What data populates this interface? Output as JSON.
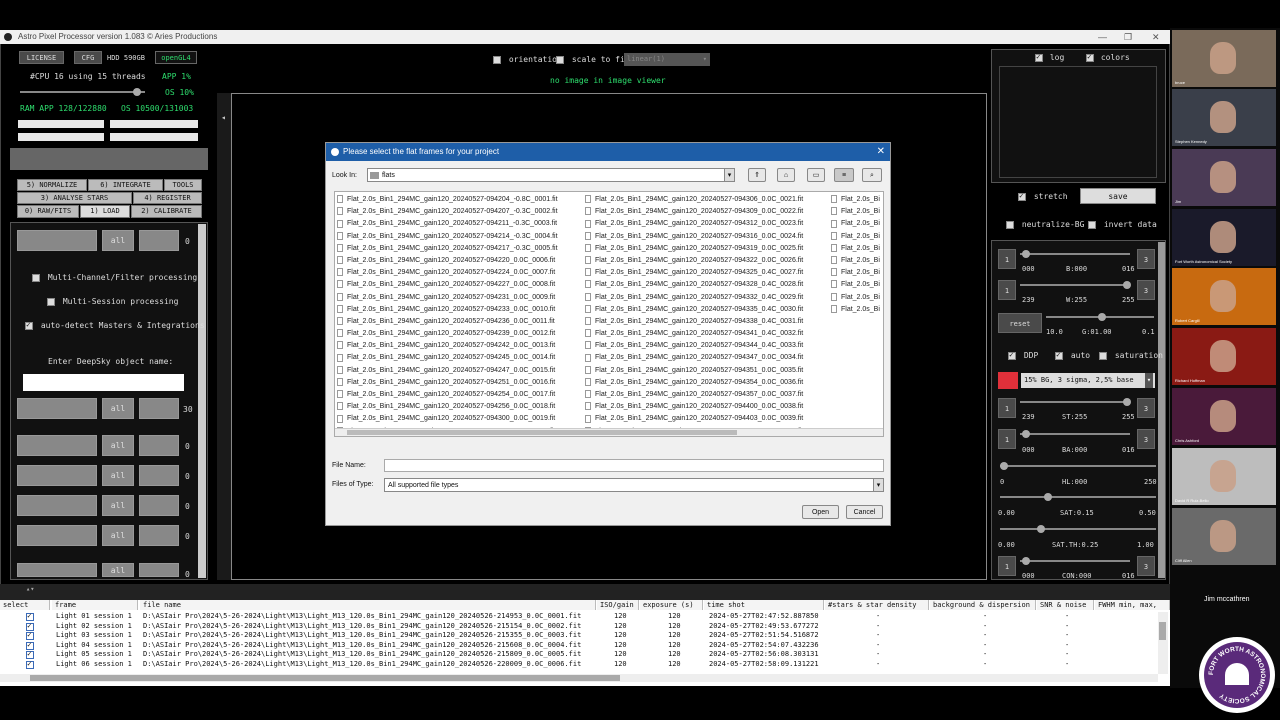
{
  "app": {
    "title": "Astro Pixel Processor version 1.083 © Aries Productions",
    "window_controls": [
      "—",
      "❐",
      "✕"
    ]
  },
  "top_left": {
    "license": "LICENSE",
    "cfg": "CFG",
    "hdd": "HDD 590GB",
    "opengl": "openGL4",
    "cpu_text": "#CPU 16  using 15 threads",
    "app_pct": "APP 1%",
    "os_pct": "OS 10%",
    "ram_text": "RAM  APP 128/122880",
    "os_ram": "OS 10500/131003"
  },
  "tabs": {
    "row1": [
      "5) NORMALIZE",
      "6) INTEGRATE",
      "TOOLS"
    ],
    "row2": [
      "3) ANALYSE STARS",
      "4) REGISTER"
    ],
    "row3": [
      "0) RAW/FITS",
      "1) LOAD",
      "2) CALIBRATE"
    ]
  },
  "load_panel": {
    "all_label": "all",
    "count0": "0",
    "multi_channel": "Multi-Channel/Filter processing",
    "multi_session": "Multi-Session processing",
    "auto_detect": "auto-detect Masters & Integrations",
    "deepsky_label": "Enter DeepSky object name:",
    "deepsky_value": "",
    "count30": "30",
    "counts": [
      "0",
      "0",
      "0",
      "0",
      "0"
    ]
  },
  "viewer": {
    "orientation": "orientation",
    "scale_to_fit": "scale to fit",
    "stretch_select": "linear(1)",
    "no_image": "no image in image viewer"
  },
  "right_panel": {
    "log": "log",
    "colors": "colors",
    "stretch": "stretch",
    "save": "save",
    "neutralize": "neutralize-BG",
    "invert": "invert data",
    "b_min": "000",
    "b_label": "B:000",
    "b_max": "016",
    "w_min": "239",
    "w_label": "W:255",
    "w_max": "255",
    "reset": "reset",
    "g_min": "10.0",
    "g_label": "G:01.00",
    "g_max": "0.1",
    "ddp": "DDP",
    "auto": "auto",
    "saturation": "saturation",
    "preset": "15% BG, 3 sigma, 2,5% base",
    "st_min": "239",
    "st_label": "ST:255",
    "st_max": "255",
    "ba_min": "000",
    "ba_label": "BA:000",
    "ba_max": "016",
    "hl_min": "0",
    "hl_label": "HL:000",
    "hl_max": "250",
    "sat_min": "0.00",
    "sat_label": "SAT:0.15",
    "sat_max": "0.50",
    "satth_min": "0.00",
    "satth_label": "SAT.TH:0.25",
    "satth_max": "1.00",
    "con_min": "000",
    "con_label": "CON:000",
    "con_max": "016",
    "spin_1": "1",
    "spin_3": "3"
  },
  "dialog": {
    "title": "Please select the flat frames for your project",
    "look_in_label": "Look In:",
    "look_in_value": "flats",
    "file_name_label": "File Name:",
    "file_name_value": "",
    "file_type_label": "Files of Type:",
    "file_type_value": "All supported file types",
    "open": "Open",
    "cancel": "Cancel",
    "col1": [
      "Flat_2.0s_Bin1_294MC_gain120_20240527-094204_-0.8C_0001.fit",
      "Flat_2.0s_Bin1_294MC_gain120_20240527-094207_-0.3C_0002.fit",
      "Flat_2.0s_Bin1_294MC_gain120_20240527-094211_-0.3C_0003.fit",
      "Flat_2.0s_Bin1_294MC_gain120_20240527-094214_-0.3C_0004.fit",
      "Flat_2.0s_Bin1_294MC_gain120_20240527-094217_-0.3C_0005.fit",
      "Flat_2.0s_Bin1_294MC_gain120_20240527-094220_0.0C_0006.fit",
      "Flat_2.0s_Bin1_294MC_gain120_20240527-094224_0.0C_0007.fit",
      "Flat_2.0s_Bin1_294MC_gain120_20240527-094227_0.0C_0008.fit",
      "Flat_2.0s_Bin1_294MC_gain120_20240527-094231_0.0C_0009.fit",
      "Flat_2.0s_Bin1_294MC_gain120_20240527-094233_0.0C_0010.fit",
      "Flat_2.0s_Bin1_294MC_gain120_20240527-094236_0.0C_0011.fit",
      "Flat_2.0s_Bin1_294MC_gain120_20240527-094239_0.0C_0012.fit",
      "Flat_2.0s_Bin1_294MC_gain120_20240527-094242_0.0C_0013.fit",
      "Flat_2.0s_Bin1_294MC_gain120_20240527-094245_0.0C_0014.fit",
      "Flat_2.0s_Bin1_294MC_gain120_20240527-094247_0.0C_0015.fit",
      "Flat_2.0s_Bin1_294MC_gain120_20240527-094251_0.0C_0016.fit",
      "Flat_2.0s_Bin1_294MC_gain120_20240527-094254_0.0C_0017.fit",
      "Flat_2.0s_Bin1_294MC_gain120_20240527-094256_0.0C_0018.fit",
      "Flat_2.0s_Bin1_294MC_gain120_20240527-094300_0.0C_0019.fit",
      "Flat_2.0s_Bin1_294MC_gain120_20240527-094303_0.0C_0020.fit"
    ],
    "col2": [
      "Flat_2.0s_Bin1_294MC_gain120_20240527-094306_0.0C_0021.fit",
      "Flat_2.0s_Bin1_294MC_gain120_20240527-094309_0.0C_0022.fit",
      "Flat_2.0s_Bin1_294MC_gain120_20240527-094312_0.0C_0023.fit",
      "Flat_2.0s_Bin1_294MC_gain120_20240527-094316_0.0C_0024.fit",
      "Flat_2.0s_Bin1_294MC_gain120_20240527-094319_0.0C_0025.fit",
      "Flat_2.0s_Bin1_294MC_gain120_20240527-094322_0.0C_0026.fit",
      "Flat_2.0s_Bin1_294MC_gain120_20240527-094325_0.4C_0027.fit",
      "Flat_2.0s_Bin1_294MC_gain120_20240527-094328_0.4C_0028.fit",
      "Flat_2.0s_Bin1_294MC_gain120_20240527-094332_0.4C_0029.fit",
      "Flat_2.0s_Bin1_294MC_gain120_20240527-094335_0.4C_0030.fit",
      "Flat_2.0s_Bin1_294MC_gain120_20240527-094338_0.4C_0031.fit",
      "Flat_2.0s_Bin1_294MC_gain120_20240527-094341_0.4C_0032.fit",
      "Flat_2.0s_Bin1_294MC_gain120_20240527-094344_0.4C_0033.fit",
      "Flat_2.0s_Bin1_294MC_gain120_20240527-094347_0.0C_0034.fit",
      "Flat_2.0s_Bin1_294MC_gain120_20240527-094351_0.0C_0035.fit",
      "Flat_2.0s_Bin1_294MC_gain120_20240527-094354_0.0C_0036.fit",
      "Flat_2.0s_Bin1_294MC_gain120_20240527-094357_0.0C_0037.fit",
      "Flat_2.0s_Bin1_294MC_gain120_20240527-094400_0.0C_0038.fit",
      "Flat_2.0s_Bin1_294MC_gain120_20240527-094403_0.0C_0039.fit",
      "Flat_2.0s_Bin1_294MC_gain120_20240527-094406_0.0C_0040.fit"
    ],
    "col3": [
      "Flat_2.0s_Bi",
      "Flat_2.0s_Bi",
      "Flat_2.0s_Bi",
      "Flat_2.0s_Bi",
      "Flat_2.0s_Bi",
      "Flat_2.0s_Bi",
      "Flat_2.0s_Bi",
      "Flat_2.0s_Bi",
      "Flat_2.0s_Bi",
      "Flat_2.0s_Bi"
    ]
  },
  "table": {
    "headers": [
      "select",
      "frame",
      "file name",
      "ISO/gain",
      "exposure (s)",
      "time shot",
      "#stars & star density",
      "background & dispersion",
      "SNR & noise",
      "FWHM min, max,"
    ],
    "rows": [
      {
        "frame": "Light 01 session 1",
        "file": "D:\\ASIair Pro\\2024\\5-26-2024\\Light\\M13\\Light_M13_120.0s_Bin1_294MC_gain120_20240526-214953_0.0C_0001.fit",
        "iso": "120",
        "exp": "120",
        "time": "2024-05-27T02:47:52.887850",
        "stars": "-",
        "bg": "-",
        "snr": "-"
      },
      {
        "frame": "Light 02 session 1",
        "file": "D:\\ASIair Pro\\2024\\5-26-2024\\Light\\M13\\Light_M13_120.0s_Bin1_294MC_gain120_20240526-215154_0.0C_0002.fit",
        "iso": "120",
        "exp": "120",
        "time": "2024-05-27T02:49:53.677272",
        "stars": "-",
        "bg": "-",
        "snr": "-"
      },
      {
        "frame": "Light 03 session 1",
        "file": "D:\\ASIair Pro\\2024\\5-26-2024\\Light\\M13\\Light_M13_120.0s_Bin1_294MC_gain120_20240526-215355_0.0C_0003.fit",
        "iso": "120",
        "exp": "120",
        "time": "2024-05-27T02:51:54.516872",
        "stars": "-",
        "bg": "-",
        "snr": "-"
      },
      {
        "frame": "Light 04 session 1",
        "file": "D:\\ASIair Pro\\2024\\5-26-2024\\Light\\M13\\Light_M13_120.0s_Bin1_294MC_gain120_20240526-215608_0.0C_0004.fit",
        "iso": "120",
        "exp": "120",
        "time": "2024-05-27T02:54:07.432236",
        "stars": "-",
        "bg": "-",
        "snr": "-"
      },
      {
        "frame": "Light 05 session 1",
        "file": "D:\\ASIair Pro\\2024\\5-26-2024\\Light\\M13\\Light_M13_120.0s_Bin1_294MC_gain120_20240526-215809_0.0C_0005.fit",
        "iso": "120",
        "exp": "120",
        "time": "2024-05-27T02:56:08.303131",
        "stars": "-",
        "bg": "-",
        "snr": "-"
      },
      {
        "frame": "Light 06 session 1",
        "file": "D:\\ASIair Pro\\2024\\5-26-2024\\Light\\M13\\Light_M13_120.0s_Bin1_294MC_gain120_20240526-220009_0.0C_0006.fit",
        "iso": "120",
        "exp": "120",
        "time": "2024-05-27T02:58:09.131221",
        "stars": "-",
        "bg": "-",
        "snr": "-"
      }
    ]
  },
  "participants": [
    {
      "name": "bruce",
      "color": "#7a6a5a"
    },
    {
      "name": "Stephen Kennedy",
      "color": "#3a3f4a"
    },
    {
      "name": "Jim",
      "color": "#4a3a55"
    },
    {
      "name": "Fort Worth Astronomical Society",
      "color": "#1a1a2a"
    },
    {
      "name": "Robert Cargill",
      "color": "#c86a10"
    },
    {
      "name": "Richard Hoffman",
      "color": "#8a1a14"
    },
    {
      "name": "Chris Ashford",
      "color": "#4a1a3a"
    },
    {
      "name": "David R Ruiz-Bello",
      "color": "#bdbdbd"
    },
    {
      "name": "Cliff Allen",
      "color": "#6a6a6a"
    }
  ],
  "active_speaker": "Jim mccathren",
  "logo_text": "FORT WORTH ASTRONOMICAL SOCIETY"
}
